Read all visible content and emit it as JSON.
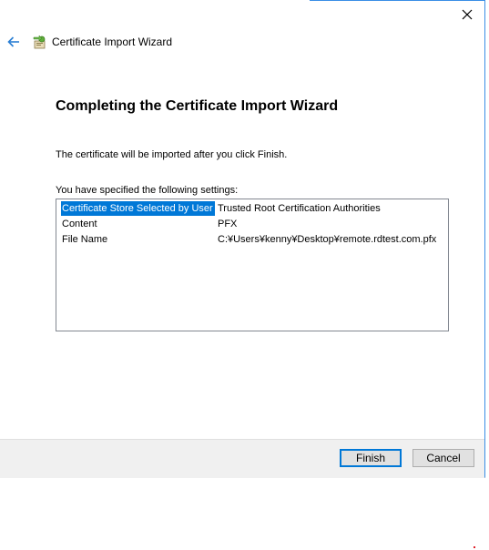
{
  "window": {
    "title": "Certificate Import Wizard",
    "icons": {
      "close": "close-icon",
      "back": "back-arrow-icon",
      "wizard": "certificate-wizard-icon"
    }
  },
  "page": {
    "heading": "Completing the Certificate Import Wizard",
    "info_text": "The certificate will be imported after you click Finish.",
    "settings_label": "You have specified the following settings:",
    "settings": [
      {
        "key": "Certificate Store Selected by User",
        "value": "Trusted Root Certification Authorities",
        "selected": true
      },
      {
        "key": "Content",
        "value": "PFX",
        "selected": false
      },
      {
        "key": "File Name",
        "value": "C:¥Users¥kenny¥Desktop¥remote.rdtest.com.pfx",
        "selected": false
      }
    ]
  },
  "footer": {
    "finish_label": "Finish",
    "cancel_label": "Cancel"
  },
  "colors": {
    "accent": "#0078d7",
    "window_border": "#3a8ee6",
    "footer_bg": "#f0f0f0"
  }
}
